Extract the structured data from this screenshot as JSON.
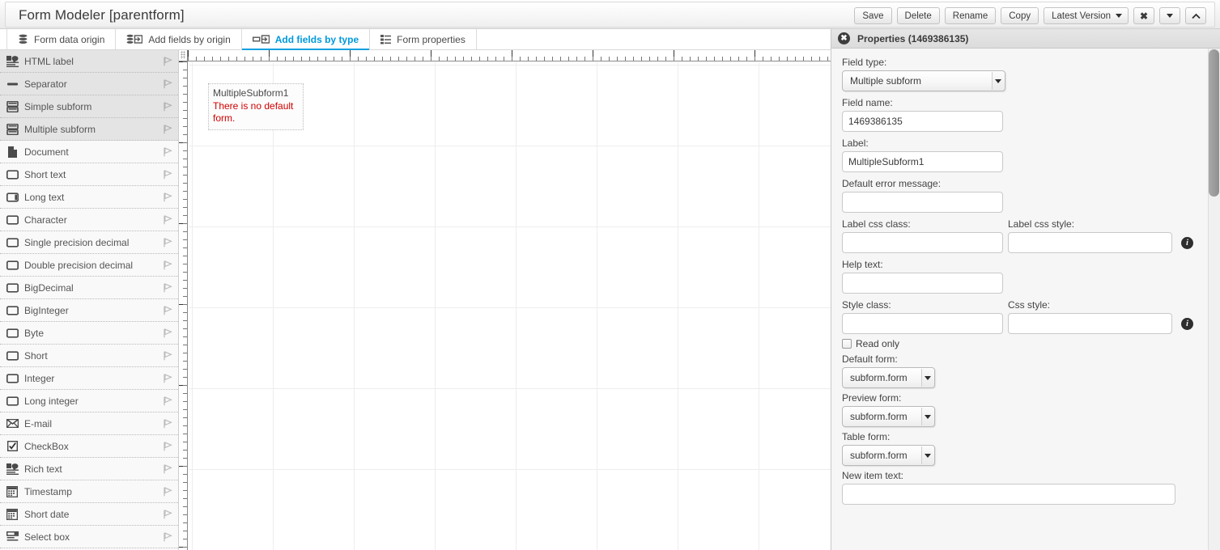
{
  "window": {
    "title": "Form Modeler [parentform]"
  },
  "toolbar": {
    "save_label": "Save",
    "delete_label": "Delete",
    "rename_label": "Rename",
    "copy_label": "Copy",
    "version_label": "Latest Version",
    "close_label": "✖",
    "expand_label": "",
    "collapse_label": ""
  },
  "tabs": [
    {
      "label": "Form data origin",
      "icon": "database-icon",
      "active": false
    },
    {
      "label": "Add fields by origin",
      "icon": "database-import-icon",
      "active": false
    },
    {
      "label": "Add fields by type",
      "icon": "field-import-icon",
      "active": true
    },
    {
      "label": "Form properties",
      "icon": "list-properties-icon",
      "active": false
    }
  ],
  "sidebar": {
    "items": [
      {
        "label": "HTML label",
        "icon": "html-label-icon",
        "shaded": true
      },
      {
        "label": "Separator",
        "icon": "separator-icon",
        "shaded": true
      },
      {
        "label": "Simple subform",
        "icon": "subform-icon",
        "shaded": true
      },
      {
        "label": "Multiple subform",
        "icon": "subform-icon",
        "shaded": true
      },
      {
        "label": "Document",
        "icon": "document-icon",
        "shaded": false
      },
      {
        "label": "Short text",
        "icon": "textbox-icon",
        "shaded": false
      },
      {
        "label": "Long text",
        "icon": "textarea-icon",
        "shaded": false
      },
      {
        "label": "Character",
        "icon": "textbox-icon",
        "shaded": false
      },
      {
        "label": "Single precision decimal",
        "icon": "textbox-icon",
        "shaded": false
      },
      {
        "label": "Double precision decimal",
        "icon": "textbox-icon",
        "shaded": false
      },
      {
        "label": "BigDecimal",
        "icon": "textbox-icon",
        "shaded": false
      },
      {
        "label": "BigInteger",
        "icon": "textbox-icon",
        "shaded": false
      },
      {
        "label": "Byte",
        "icon": "textbox-icon",
        "shaded": false
      },
      {
        "label": "Short",
        "icon": "textbox-icon",
        "shaded": false
      },
      {
        "label": "Integer",
        "icon": "textbox-icon",
        "shaded": false
      },
      {
        "label": "Long integer",
        "icon": "textbox-icon",
        "shaded": false
      },
      {
        "label": "E-mail",
        "icon": "envelope-icon",
        "shaded": false
      },
      {
        "label": "CheckBox",
        "icon": "checkbox-icon",
        "shaded": false
      },
      {
        "label": "Rich text",
        "icon": "rich-text-icon",
        "shaded": false
      },
      {
        "label": "Timestamp",
        "icon": "calendar-icon",
        "shaded": false
      },
      {
        "label": "Short date",
        "icon": "calendar-icon",
        "shaded": false
      },
      {
        "label": "Select box",
        "icon": "select-box-icon",
        "shaded": false
      }
    ]
  },
  "canvas": {
    "widget": {
      "label": "MultipleSubform1",
      "error": "There is no default form."
    }
  },
  "properties": {
    "header_title": "Properties (1469386135)",
    "field_type_label": "Field type:",
    "field_type_value": "Multiple subform",
    "field_name_label": "Field name:",
    "field_name_value": "1469386135",
    "label_label": "Label:",
    "label_value": "MultipleSubform1",
    "default_error_label": "Default error message:",
    "default_error_value": "",
    "label_css_class_label": "Label css class:",
    "label_css_class_value": "",
    "label_css_style_label": "Label css style:",
    "label_css_style_value": "",
    "help_text_label": "Help text:",
    "help_text_value": "",
    "style_class_label": "Style class:",
    "style_class_value": "",
    "css_style_label": "Css style:",
    "css_style_value": "",
    "read_only_label": "Read only",
    "read_only_checked": false,
    "default_form_label": "Default form:",
    "default_form_value": "subform.form",
    "preview_form_label": "Preview form:",
    "preview_form_value": "subform.form",
    "table_form_label": "Table form:",
    "table_form_value": "subform.form",
    "new_item_text_label": "New item text:",
    "new_item_text_value": "",
    "info_icon": "info-icon"
  },
  "colors": {
    "accent": "#0099dd",
    "error": "#d00000",
    "panel_bg": "#f6f6f6",
    "sidebar_shaded": "#e4e4e4"
  }
}
